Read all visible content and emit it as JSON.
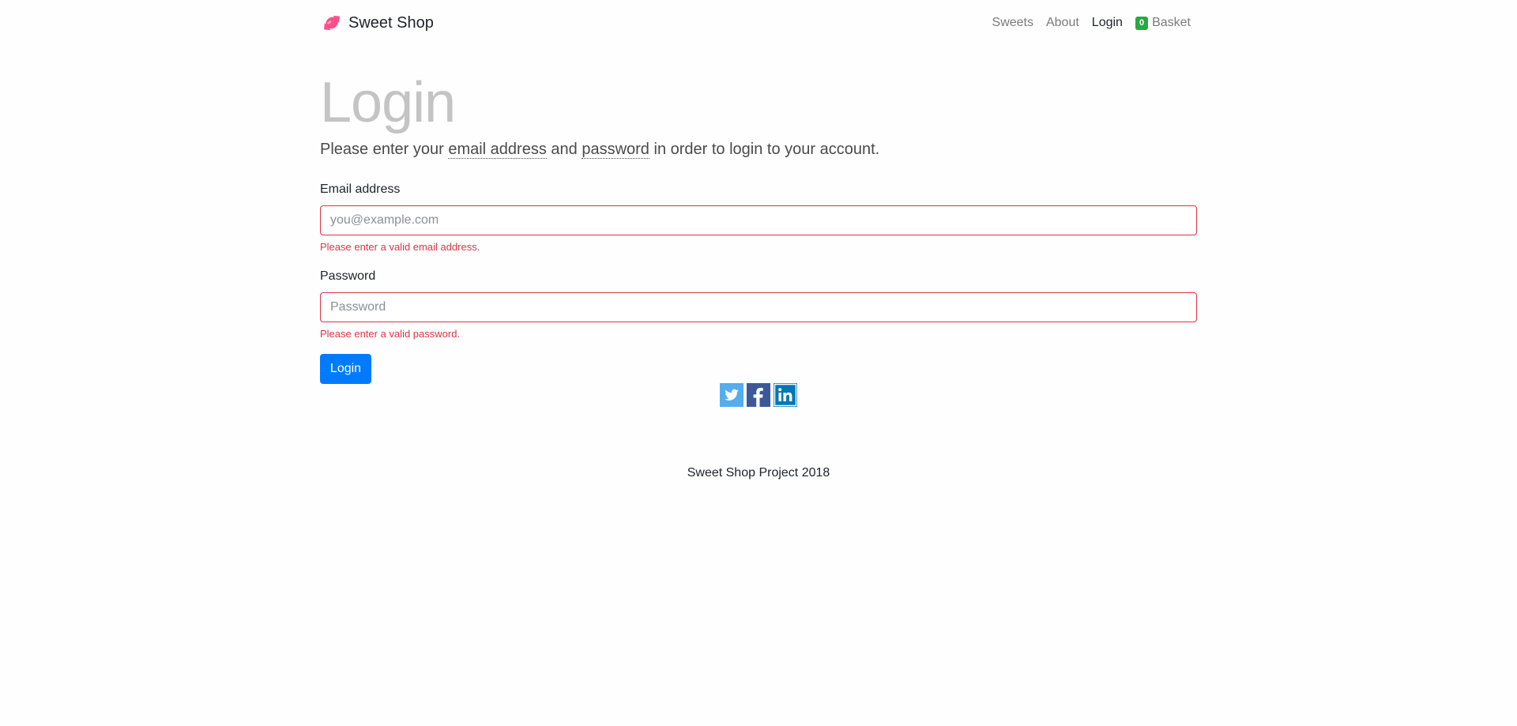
{
  "nav": {
    "brand": "Sweet Shop",
    "links": [
      {
        "label": "Sweets"
      },
      {
        "label": "About"
      },
      {
        "label": "Login"
      }
    ],
    "basket": {
      "count": "0",
      "label": "Basket"
    }
  },
  "page": {
    "title": "Login",
    "lead_pre": "Please enter your ",
    "lead_email": "email address",
    "lead_mid": " and ",
    "lead_password": "password",
    "lead_post": " in order to login to your account."
  },
  "form": {
    "email_label": "Email address",
    "email_placeholder": "you@example.com",
    "email_error": "Please enter a valid email address.",
    "password_label": "Password",
    "password_placeholder": "Password",
    "password_error": "Please enter a valid password.",
    "submit": "Login"
  },
  "social": {
    "icons": [
      "twitter-icon",
      "facebook-icon",
      "linkedin-icon"
    ],
    "colors": {
      "twitter": "#55acee",
      "facebook": "#3b5998",
      "linkedin": "#0077b5"
    }
  },
  "footer": {
    "text": "Sweet Shop Project 2018"
  },
  "colors": {
    "brand_pink": "#ff4f88",
    "primary": "#007bff",
    "danger": "#dc3545",
    "badge": "#28a745"
  }
}
